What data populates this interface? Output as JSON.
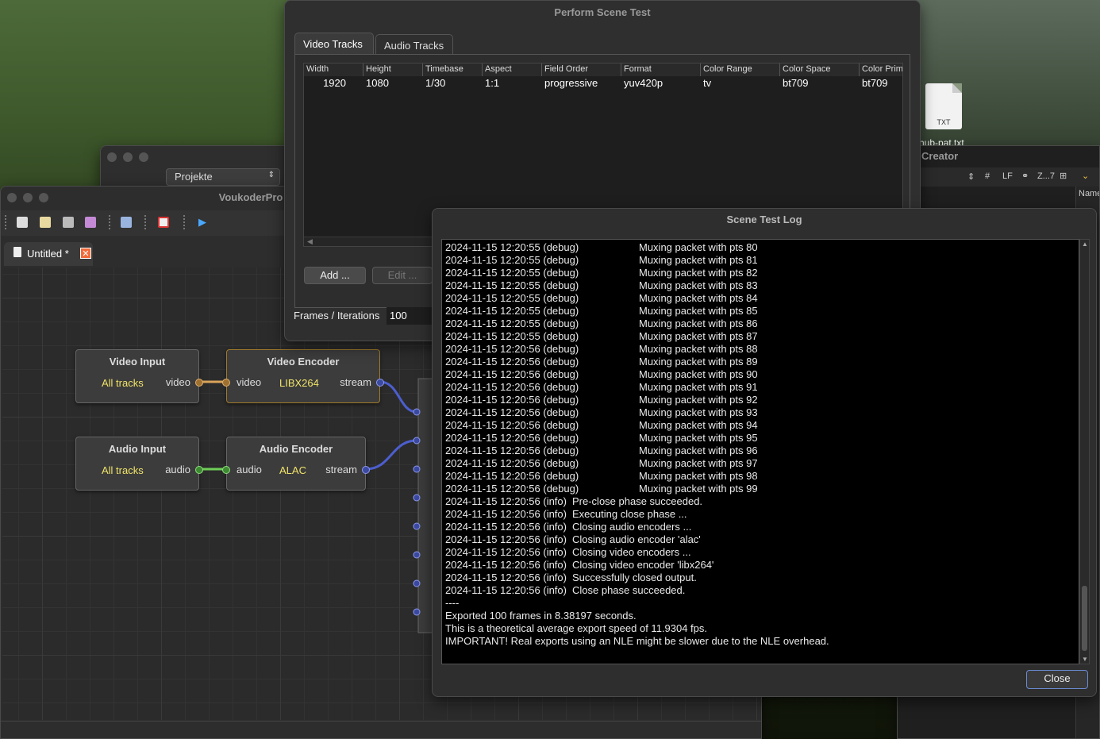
{
  "desktop": {
    "file_icon_label": "TXT",
    "file_name": "hub-pat.txt"
  },
  "creator": {
    "title": "Creator",
    "toolbar": [
      "#",
      "LF",
      "Z...7"
    ],
    "column_header": "Name"
  },
  "projekte": {
    "select_value": "Projekte"
  },
  "voukoder": {
    "title": "VoukoderPro",
    "tab_label": "Untitled *",
    "nodes": {
      "video_input": {
        "title": "Video Input",
        "left": "All tracks",
        "right": "video"
      },
      "video_encoder": {
        "title": "Video Encoder",
        "left": "video",
        "middle": "LIBX264",
        "right": "stream"
      },
      "audio_input": {
        "title": "Audio Input",
        "left": "All tracks",
        "right": "audio"
      },
      "audio_encoder": {
        "title": "Audio Encoder",
        "left": "audio",
        "middle": "ALAC",
        "right": "stream"
      }
    },
    "colors": {
      "video_link": "#d9a35a",
      "audio_link": "#6fcf57",
      "stream_link": "#4c5ecf"
    }
  },
  "perform": {
    "title": "Perform Scene Test",
    "tabs": [
      "Video Tracks",
      "Audio Tracks"
    ],
    "columns": [
      "Width",
      "Height",
      "Timebase",
      "Aspect",
      "Field Order",
      "Format",
      "Color Range",
      "Color Space",
      "Color Prim"
    ],
    "row": [
      "1920",
      "1080",
      "1/30",
      "1:1",
      "progressive",
      "yuv420p",
      "tv",
      "bt709",
      "bt709"
    ],
    "add_button": "Add ...",
    "edit_button": "Edit ...",
    "frames_label": "Frames / Iterations",
    "frames_value": "100"
  },
  "log": {
    "title": "Scene Test Log",
    "debug_lines": [
      [
        "2024-11-15 12:20:55 (debug)",
        "Muxing packet with pts 80"
      ],
      [
        "2024-11-15 12:20:55 (debug)",
        "Muxing packet with pts 81"
      ],
      [
        "2024-11-15 12:20:55 (debug)",
        "Muxing packet with pts 82"
      ],
      [
        "2024-11-15 12:20:55 (debug)",
        "Muxing packet with pts 83"
      ],
      [
        "2024-11-15 12:20:55 (debug)",
        "Muxing packet with pts 84"
      ],
      [
        "2024-11-15 12:20:55 (debug)",
        "Muxing packet with pts 85"
      ],
      [
        "2024-11-15 12:20:55 (debug)",
        "Muxing packet with pts 86"
      ],
      [
        "2024-11-15 12:20:55 (debug)",
        "Muxing packet with pts 87"
      ],
      [
        "2024-11-15 12:20:56 (debug)",
        "Muxing packet with pts 88"
      ],
      [
        "2024-11-15 12:20:56 (debug)",
        "Muxing packet with pts 89"
      ],
      [
        "2024-11-15 12:20:56 (debug)",
        "Muxing packet with pts 90"
      ],
      [
        "2024-11-15 12:20:56 (debug)",
        "Muxing packet with pts 91"
      ],
      [
        "2024-11-15 12:20:56 (debug)",
        "Muxing packet with pts 92"
      ],
      [
        "2024-11-15 12:20:56 (debug)",
        "Muxing packet with pts 93"
      ],
      [
        "2024-11-15 12:20:56 (debug)",
        "Muxing packet with pts 94"
      ],
      [
        "2024-11-15 12:20:56 (debug)",
        "Muxing packet with pts 95"
      ],
      [
        "2024-11-15 12:20:56 (debug)",
        "Muxing packet with pts 96"
      ],
      [
        "2024-11-15 12:20:56 (debug)",
        "Muxing packet with pts 97"
      ],
      [
        "2024-11-15 12:20:56 (debug)",
        "Muxing packet with pts 98"
      ],
      [
        "2024-11-15 12:20:56 (debug)",
        "Muxing packet with pts 99"
      ]
    ],
    "info_lines": [
      [
        "2024-11-15 12:20:56 (info)",
        "Pre-close phase succeeded."
      ],
      [
        "2024-11-15 12:20:56 (info)",
        "Executing close phase ..."
      ],
      [
        "2024-11-15 12:20:56 (info)",
        "Closing audio encoders ..."
      ],
      [
        "2024-11-15 12:20:56 (info)",
        "Closing audio encoder 'alac'"
      ],
      [
        "2024-11-15 12:20:56 (info)",
        "Closing video encoders ..."
      ],
      [
        "2024-11-15 12:20:56 (info)",
        "Closing video encoder 'libx264'"
      ],
      [
        "2024-11-15 12:20:56 (info)",
        "Successfully closed output."
      ],
      [
        "2024-11-15 12:20:56 (info)",
        "Close phase succeeded."
      ]
    ],
    "summary": [
      "----",
      "Exported 100 frames in 8.38197 seconds.",
      "This is a theoretical average export speed of 11.9304 fps.",
      "IMPORTANT! Real exports using an NLE might be slower due to the NLE overhead."
    ],
    "close_button": "Close"
  }
}
